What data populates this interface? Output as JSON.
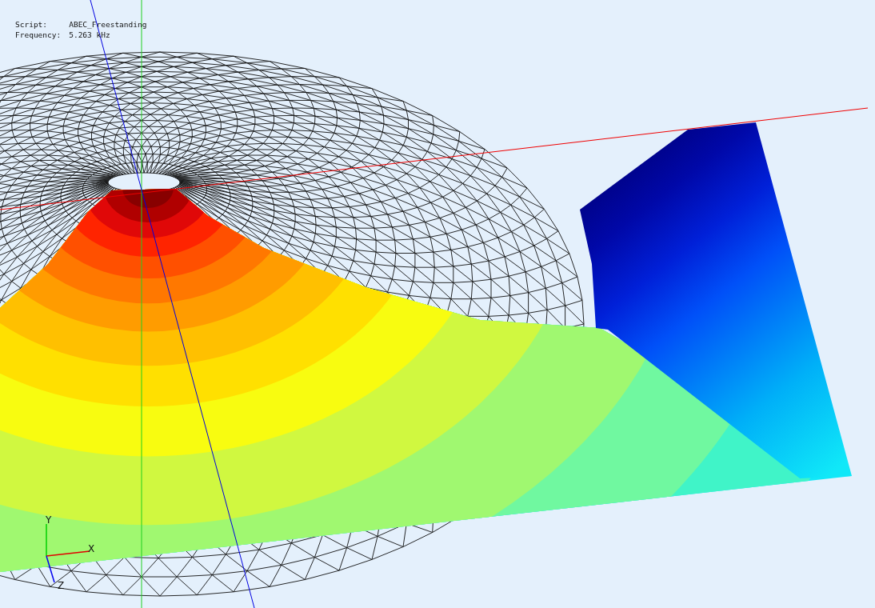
{
  "info": [
    {
      "label": "Script:",
      "value": "ABEC_Freestanding"
    },
    {
      "label": "Frequency:",
      "value": "5.263 kHz"
    }
  ],
  "axes": [
    {
      "kind": "y",
      "label": "Y"
    },
    {
      "kind": "x",
      "label": "X"
    },
    {
      "kind": "z",
      "label": "Z"
    }
  ]
}
